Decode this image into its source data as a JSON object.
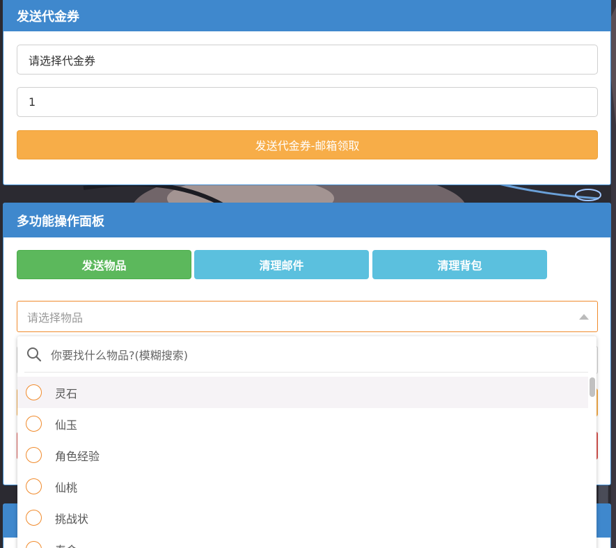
{
  "voucher_panel": {
    "title": "发送代金券",
    "voucher_select_value": "请选择代金券",
    "quantity_value": "1",
    "send_button_label": "发送代金券-邮箱领取"
  },
  "multi_panel": {
    "title": "多功能操作面板",
    "tabs": [
      {
        "label": "发送物品",
        "color": "#5cb85c"
      },
      {
        "label": "清理邮件",
        "color": "#5bc0de"
      },
      {
        "label": "清理背包",
        "color": "#5bc0de"
      }
    ],
    "item_select_placeholder": "请选择物品"
  },
  "item_dropdown": {
    "search_placeholder": "你要找什么物品?(模糊搜索)",
    "options": [
      "灵石",
      "仙玉",
      "角色经验",
      "仙桃",
      "挑战状",
      "寿命"
    ]
  },
  "colors": {
    "header_blue": "#3f88cd",
    "orange_button": "#f7ad48",
    "green_tab": "#5cb85c",
    "cyan_tab": "#5bc0de",
    "select_border": "#f08a2b"
  }
}
